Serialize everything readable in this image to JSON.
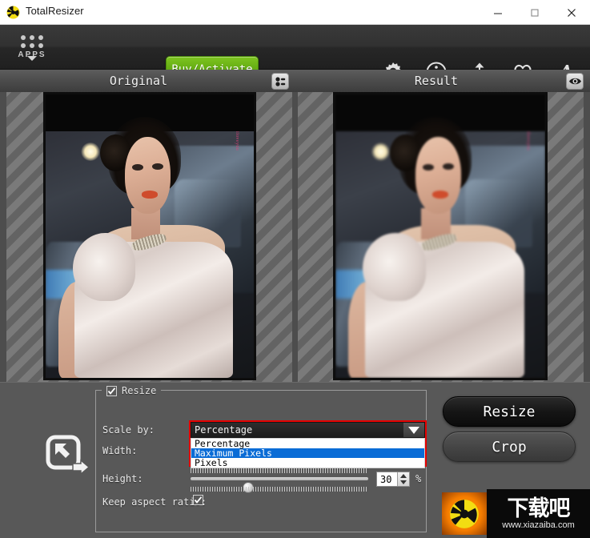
{
  "window": {
    "title": "TotalResizer",
    "app_icon": "radiation-logo-icon",
    "minimize_label": "–",
    "maximize_label": "□",
    "close_label": "✕"
  },
  "toolbar": {
    "apps_label": "APPS",
    "apps_icon": "apps-grid-icon",
    "buy_label": "Buy/Activate",
    "icons": [
      {
        "name": "settings-gear-icon",
        "label": "Settings"
      },
      {
        "name": "info-circle-icon",
        "label": "Info"
      },
      {
        "name": "share-upload-icon",
        "label": "Share"
      },
      {
        "name": "heart-icon",
        "label": "Favorite"
      },
      {
        "name": "font-letter-a-icon",
        "label": "Text"
      }
    ]
  },
  "panels": {
    "original": {
      "title": "Original",
      "button_icon": "layout-list-toggle-icon",
      "image_watermark": "iloveyou"
    },
    "result": {
      "title": "Result",
      "button_icon": "eye-preview-icon",
      "image_watermark": "iloveyou"
    }
  },
  "controls": {
    "resize_icon": "scale-arrow-icon",
    "group": {
      "legend": "Resize",
      "checked": true
    },
    "labels": {
      "scale_by": "Scale by:",
      "width": "Width:",
      "height": "Height:",
      "keep_aspect_ratio": "Keep aspect ratio:"
    },
    "scale_by": {
      "selected": "Percentage",
      "expanded": true,
      "highlighted_option": "Maximum Pixels",
      "options": [
        "Percentage",
        "Maximum Pixels",
        "Pixels"
      ]
    },
    "slider": {
      "value": "30",
      "unit": "%",
      "percent_position": 30
    },
    "keep_aspect_ratio_checked": true
  },
  "actions": {
    "resize_label": "Resize",
    "crop_label": "Crop"
  },
  "watermark": {
    "text_cn": "下载吧",
    "url": "www.xiazaiba.com",
    "badge_icon": "radiation-logo-icon"
  },
  "colors": {
    "accent_green": "#63ab12",
    "highlight_red": "#e60000",
    "selection_blue": "#0a6cd6",
    "toolbar_dark": "#2b2b2b",
    "panel_gray": "#585858"
  }
}
